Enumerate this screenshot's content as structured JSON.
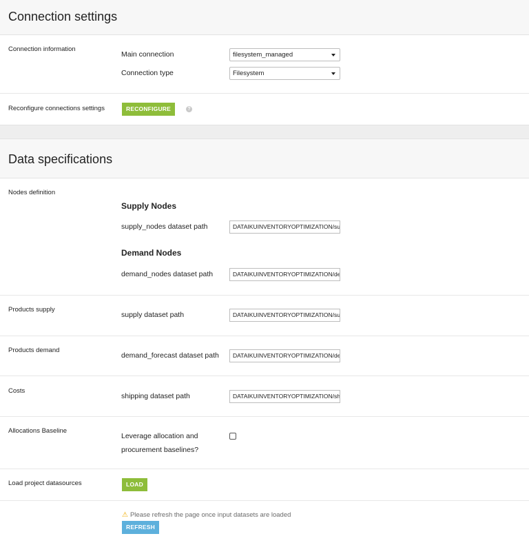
{
  "connection_section": {
    "title": "Connection settings",
    "connection_information": {
      "label": "Connection information",
      "main_connection": {
        "label": "Main connection",
        "value": "filesystem_managed"
      },
      "connection_type": {
        "label": "Connection type",
        "value": "Filesystem"
      }
    },
    "reconfigure": {
      "label": "Reconfigure connections settings",
      "button_label": "RECONFIGURE",
      "help_glyph": "?"
    }
  },
  "data_section": {
    "title": "Data specifications",
    "nodes_definition": {
      "label": "Nodes definition",
      "supply_nodes": {
        "heading": "Supply Nodes",
        "field_label": "supply_nodes dataset path",
        "value": "DATAIKUINVENTORYOPTIMIZATION/supply_nodes"
      },
      "demand_nodes": {
        "heading": "Demand Nodes",
        "field_label": "demand_nodes dataset path",
        "value": "DATAIKUINVENTORYOPTIMIZATION/demand_nodes"
      }
    },
    "products_supply": {
      "label": "Products supply",
      "field_label": "supply dataset path",
      "value": "DATAIKUINVENTORYOPTIMIZATION/supply"
    },
    "products_demand": {
      "label": "Products demand",
      "field_label": "demand_forecast dataset path",
      "value": "DATAIKUINVENTORYOPTIMIZATION/demand_forecast"
    },
    "costs": {
      "label": "Costs",
      "field_label": "shipping dataset path",
      "value": "DATAIKUINVENTORYOPTIMIZATION/shipping"
    },
    "allocations_baseline": {
      "label": "Allocations Baseline",
      "field_label_line1": "Leverage allocation and",
      "field_label_line2": "procurement baselines?",
      "checked": false
    },
    "load_datasources": {
      "label": "Load project datasources",
      "button_label": "LOAD"
    },
    "refresh": {
      "warning_icon": "warning-icon",
      "warning_text": "Please refresh the page once input datasets are loaded",
      "button_label": "REFRESH"
    }
  },
  "colors": {
    "green_button": "#8ebd3a",
    "blue_button": "#5db0dc",
    "warning": "#f0ad00"
  }
}
